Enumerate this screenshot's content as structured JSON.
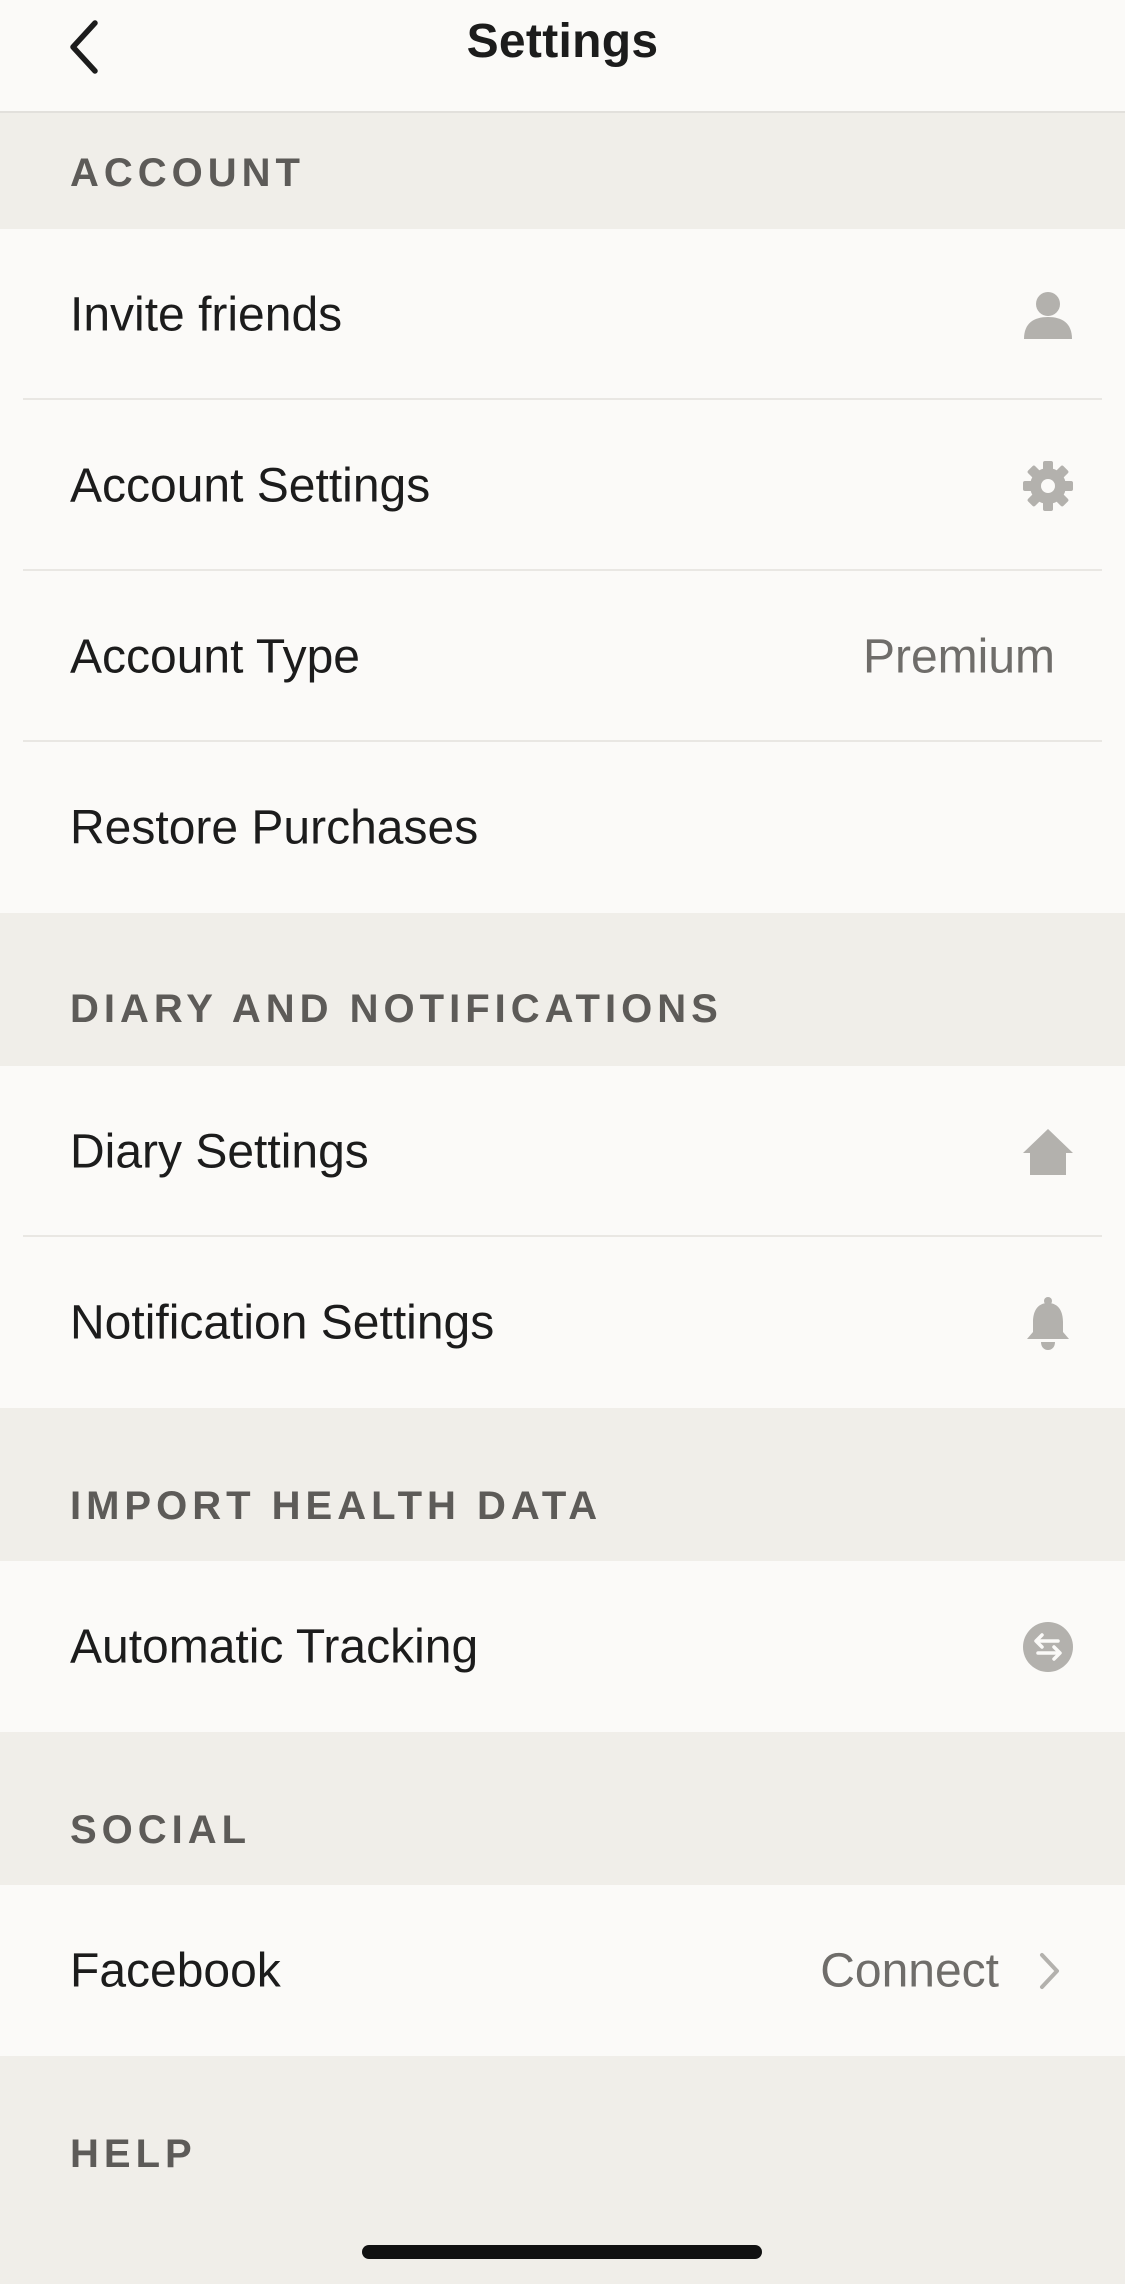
{
  "header": {
    "title": "Settings",
    "back_icon": "chevron-left-icon"
  },
  "sections": {
    "account": {
      "title": "ACCOUNT",
      "items": [
        {
          "label": "Invite friends",
          "icon": "person-icon"
        },
        {
          "label": "Account Settings",
          "icon": "gear-icon"
        },
        {
          "label": "Account Type",
          "value": "Premium"
        },
        {
          "label": "Restore Purchases"
        }
      ]
    },
    "diary": {
      "title": "DIARY AND NOTIFICATIONS",
      "items": [
        {
          "label": "Diary Settings",
          "icon": "home-icon"
        },
        {
          "label": "Notification Settings",
          "icon": "bell-icon"
        }
      ]
    },
    "health": {
      "title": "IMPORT HEALTH DATA",
      "items": [
        {
          "label": "Automatic Tracking",
          "icon": "sync-arrows-icon"
        }
      ]
    },
    "social": {
      "title": "SOCIAL",
      "items": [
        {
          "label": "Facebook",
          "value": "Connect",
          "icon": "chevron-right-icon"
        }
      ]
    },
    "help": {
      "title": "HELP"
    }
  },
  "colors": {
    "background": "#f0eee9",
    "row_background": "#fbfaf8",
    "icon_gray": "#b3b1ad",
    "section_text": "#5d5b58",
    "value_text": "#6f6d6a"
  }
}
